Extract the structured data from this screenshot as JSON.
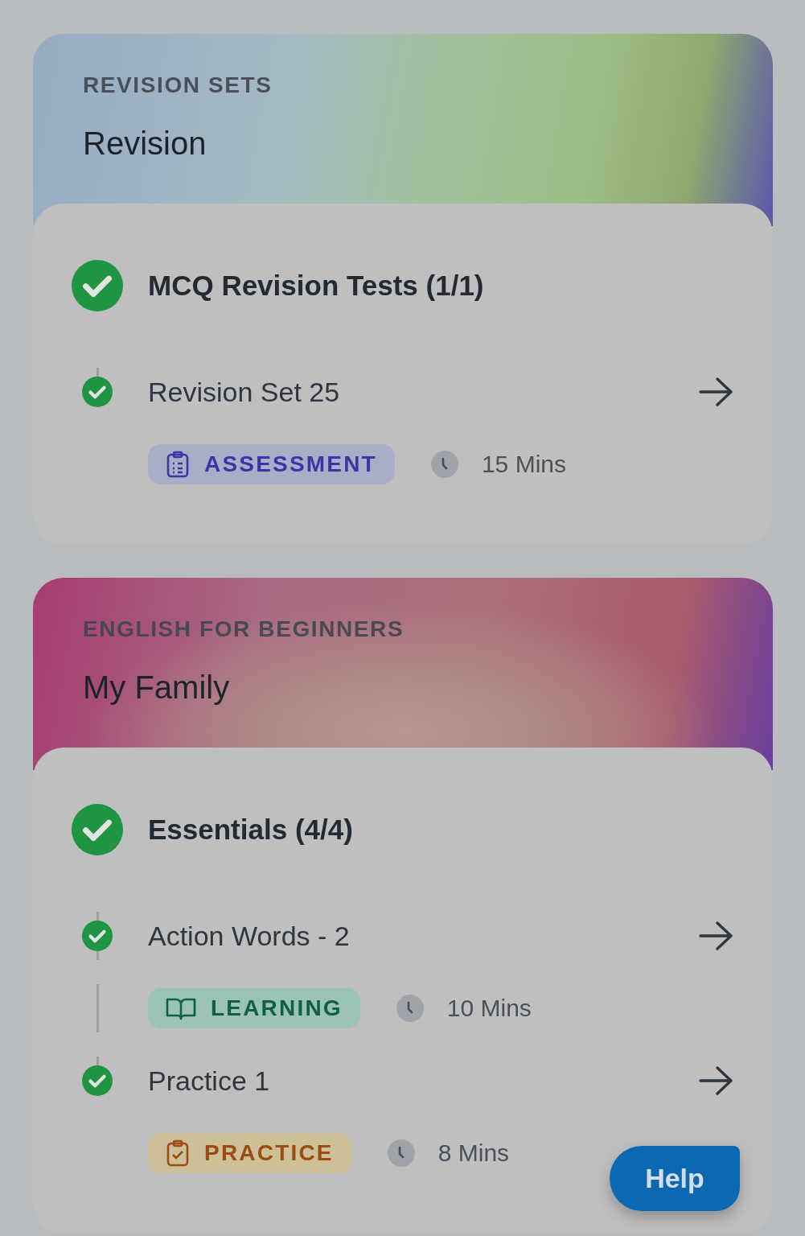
{
  "cards": [
    {
      "kind": "revision",
      "eyebrow": "REVISION SETS",
      "title": "Revision",
      "section": {
        "title": "MCQ Revision Tests (1/1)",
        "completed": true
      },
      "items": [
        {
          "title": "Revision Set 25",
          "completed": true,
          "badge": {
            "kind": "assessment",
            "label": "ASSESSMENT"
          },
          "duration": "15 Mins"
        }
      ]
    },
    {
      "kind": "english",
      "eyebrow": "ENGLISH FOR BEGINNERS",
      "title": "My Family",
      "section": {
        "title": "Essentials (4/4)",
        "completed": true
      },
      "items": [
        {
          "title": "Action Words - 2",
          "completed": true,
          "badge": {
            "kind": "learning",
            "label": "LEARNING"
          },
          "duration": "10 Mins"
        },
        {
          "title": "Practice 1",
          "completed": true,
          "badge": {
            "kind": "practice",
            "label": "PRACTICE"
          },
          "duration": "8 Mins"
        }
      ]
    }
  ],
  "help_button": {
    "label": "Help"
  }
}
